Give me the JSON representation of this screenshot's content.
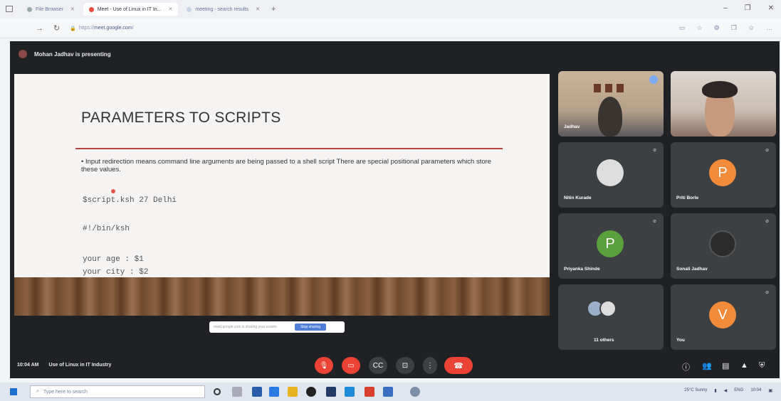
{
  "browser": {
    "tabs": [
      {
        "label": "File Browser",
        "active": false
      },
      {
        "label": "Meet - Use of Linux in IT In...",
        "active": true
      },
      {
        "label": "meeting - search results",
        "active": false
      }
    ],
    "new_tab": "+",
    "url_host": "meet.google.com",
    "url_prefix": "https://",
    "url_path": "/",
    "window_controls": [
      "–",
      "❐",
      "✕"
    ]
  },
  "meet": {
    "presenter_text": "Mohan Jadhav is presenting",
    "slide": {
      "title": "PARAMETERS TO SCRIPTS",
      "bullet": "Input redirection means command line arguments are being passed to a shell script There are special positional parameters which store these values.",
      "code_line1": "$script.ksh 27 Delhi",
      "code_line2": "#!/bin/ksh",
      "code_line3": "your age : $1",
      "code_line4": "your city : $2"
    },
    "share_bar": {
      "text": "meet.google.com is sharing your screen",
      "stop_label": "Stop sharing"
    },
    "participants": [
      {
        "name": "Jadhav",
        "type": "camera"
      },
      {
        "name": "",
        "type": "camera"
      },
      {
        "name": "Nitin Kurade",
        "type": "photo"
      },
      {
        "name": "Priti Borle",
        "type": "avatar",
        "initial": "P",
        "color": "#f28b3a"
      },
      {
        "name": "Priyanka Shinde",
        "type": "avatar",
        "initial": "P",
        "color": "#5aa03c"
      },
      {
        "name": "Sonali Jadhav",
        "type": "photo"
      },
      {
        "name": "11 others",
        "type": "others"
      },
      {
        "name": "You",
        "type": "avatar",
        "initial": "V",
        "color": "#f28b3a"
      }
    ],
    "meeting_time": "10:04 AM",
    "meeting_title": "Use of Linux in IT Industry"
  },
  "taskbar": {
    "search_placeholder": "Type here to search",
    "tray_weather": "25°C Sunny",
    "tray_lang": "ENG",
    "tray_time": "10:04"
  },
  "colors": {
    "meet_bg": "#202124",
    "tile_bg": "#3c4043",
    "red": "#ea4335",
    "accent_blue": "#4f7ed8"
  }
}
